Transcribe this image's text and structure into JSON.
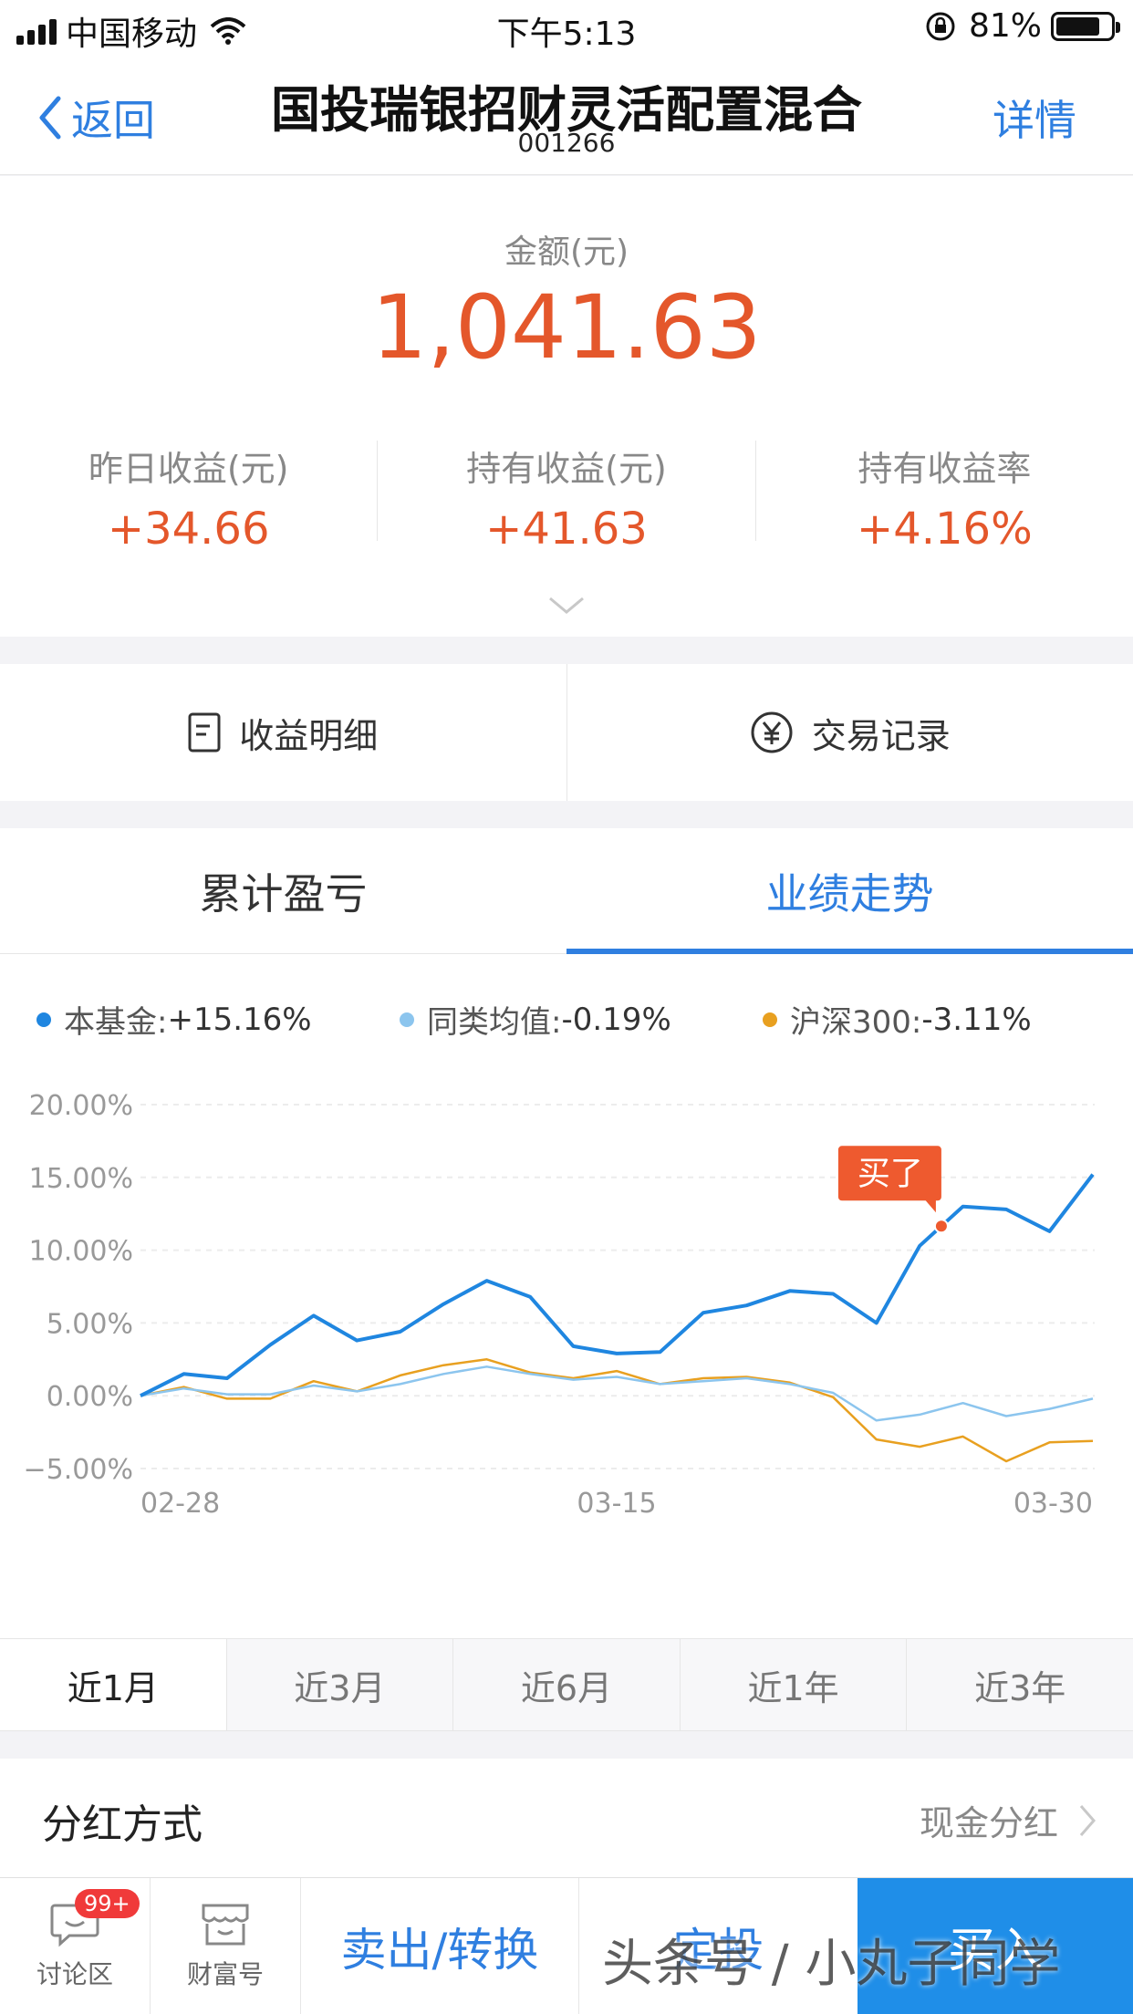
{
  "status_bar": {
    "carrier": "中国移动",
    "time": "下午5:13",
    "battery": "81%"
  },
  "nav": {
    "back_label": "返回",
    "title": "国投瑞银招财灵活配置混合",
    "code": "001266",
    "detail_label": "详情"
  },
  "summary": {
    "amount_label": "金额(元)",
    "amount": "1,041.63",
    "stats": [
      {
        "label": "昨日收益(元)",
        "value": "+34.66"
      },
      {
        "label": "持有收益(元)",
        "value": "+41.63"
      },
      {
        "label": "持有收益率",
        "value": "+4.16%"
      }
    ]
  },
  "actions": {
    "income_detail": "收益明细",
    "trade_records": "交易记录"
  },
  "tabs": {
    "cumulative": "累计盈亏",
    "performance": "业绩走势"
  },
  "legend": [
    {
      "name": "本基金:",
      "value": "+15.16%",
      "color": "#1f86e0"
    },
    {
      "name": "同类均值:",
      "value": "-0.19%",
      "color": "#8cc5ee"
    },
    {
      "name": "沪深300:",
      "value": "-3.11%",
      "color": "#e8a020"
    }
  ],
  "chart_data": {
    "type": "line",
    "y_ticks": [
      "20.00%",
      "15.00%",
      "10.00%",
      "5.00%",
      "0.00%",
      "−5.00%"
    ],
    "ylim": [
      -5,
      20
    ],
    "x_tick_labels": [
      "02-28",
      "03-15",
      "03-30"
    ],
    "x_tick_index": [
      0,
      11,
      22
    ],
    "annotation": {
      "label": "买了",
      "index": 19,
      "color": "#ee5a2f"
    },
    "series": [
      {
        "name": "本基金",
        "color": "#1f86e0",
        "values": [
          0,
          1.5,
          1.2,
          3.5,
          5.5,
          3.8,
          4.4,
          6.3,
          7.9,
          6.8,
          3.4,
          2.9,
          3.0,
          5.7,
          6.2,
          7.2,
          7.0,
          5.0,
          10.3,
          13.0,
          12.8,
          11.3,
          15.2
        ]
      },
      {
        "name": "同类均值",
        "color": "#8cc5ee",
        "values": [
          0,
          0.5,
          0.1,
          0.1,
          0.7,
          0.3,
          0.8,
          1.5,
          2.0,
          1.5,
          1.1,
          1.3,
          0.8,
          1.0,
          1.2,
          0.8,
          0.2,
          -1.7,
          -1.3,
          -0.5,
          -1.4,
          -0.9,
          -0.2
        ]
      },
      {
        "name": "沪深300",
        "color": "#e8a020",
        "values": [
          0,
          0.6,
          -0.2,
          -0.2,
          1.0,
          0.3,
          1.4,
          2.1,
          2.5,
          1.6,
          1.2,
          1.7,
          0.8,
          1.2,
          1.3,
          0.9,
          -0.1,
          -3.0,
          -3.5,
          -2.8,
          -4.5,
          -3.2,
          -3.1
        ]
      }
    ]
  },
  "periods": [
    "近1月",
    "近3月",
    "近6月",
    "近1年",
    "近3年"
  ],
  "dividend": {
    "label": "分红方式",
    "value": "现金分红"
  },
  "bottom_bar": {
    "discuss": "讨论区",
    "discuss_badge": "99+",
    "wealth": "财富号",
    "sell": "卖出/转换",
    "fixed": "定投",
    "buy": "买入"
  },
  "watermark": "头条号 / 小丸子同学"
}
